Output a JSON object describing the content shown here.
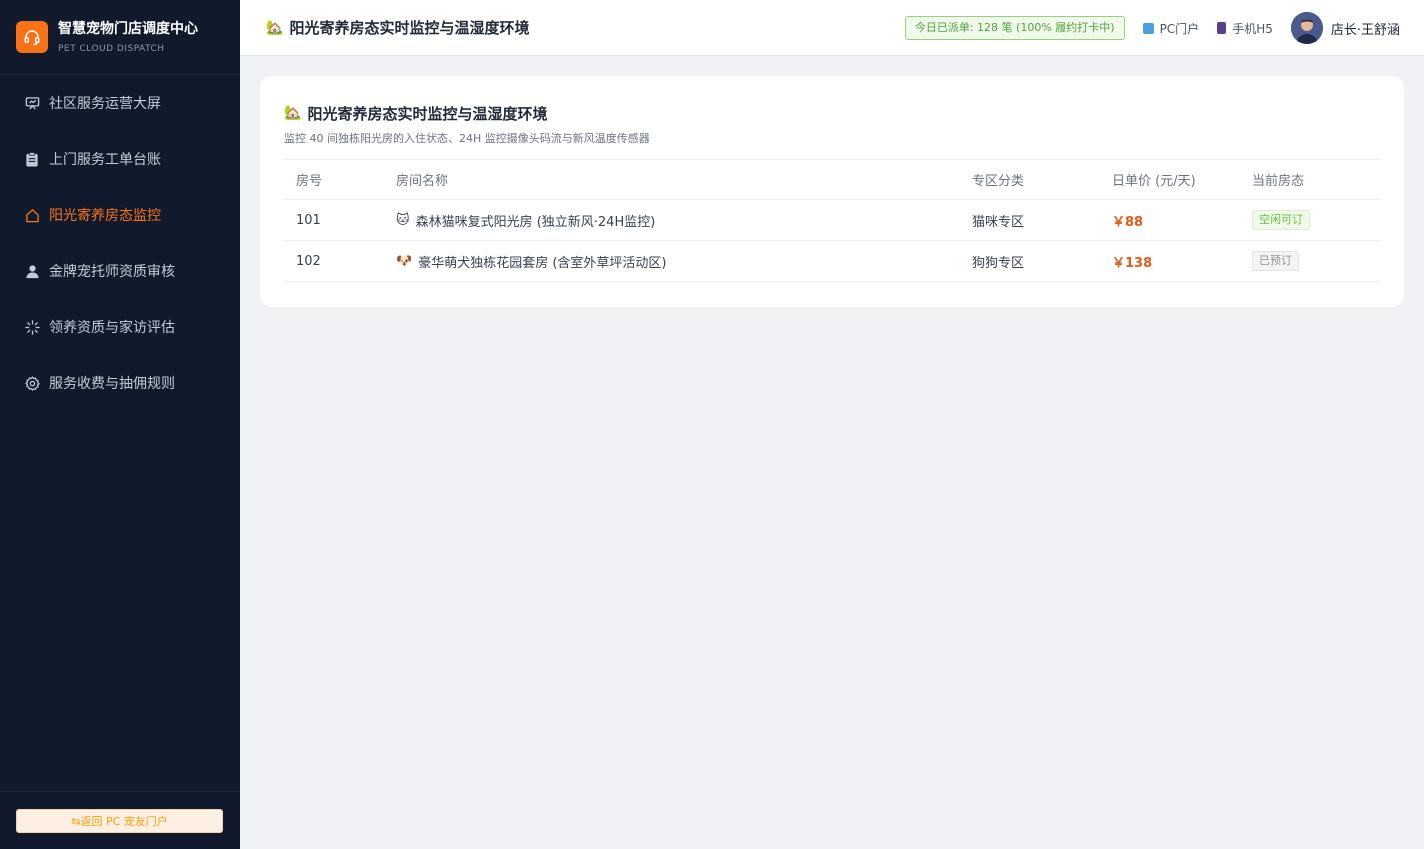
{
  "brand": {
    "title": "智慧宠物门店调度中心",
    "subtitle": "PET CLOUD DISPATCH",
    "logo_icon": "headset-icon",
    "accent": "#f97316"
  },
  "sidebar": {
    "items": [
      {
        "label": "社区服务运营大屏",
        "icon": "dashboard-icon",
        "active": false
      },
      {
        "label": "上门服务工单台账",
        "icon": "clipboard-icon",
        "active": false
      },
      {
        "label": "阳光寄养房态监控",
        "icon": "home-icon",
        "active": true
      },
      {
        "label": "金牌宠托师资质审核",
        "icon": "user-icon",
        "active": false
      },
      {
        "label": "领养资质与家访评估",
        "icon": "loading-icon",
        "active": false
      },
      {
        "label": "服务收费与抽佣规则",
        "icon": "gear-icon",
        "active": false
      }
    ],
    "back_button": "⇆返回 PC 宠友门户"
  },
  "header": {
    "emoji": "🏡",
    "title": "阳光寄养房态实时监控与温湿度环境",
    "dispatch_badge": "今日已派单: 128 笔 (100% 履约打卡中)",
    "pc_link": "PC门户",
    "mobile_link": "手机H5",
    "user_name": "店长·王舒涵"
  },
  "card": {
    "emoji": "🏡",
    "title": "阳光寄养房态实时监控与温湿度环境",
    "subtitle": "监控 40 间独栋阳光房的入住状态、24H 监控摄像头码流与新风温度传感器",
    "columns": [
      "房号",
      "房间名称",
      "专区分类",
      "日单价 (元/天)",
      "当前房态"
    ],
    "rows": [
      {
        "room_no": "101",
        "emoji": "🐱",
        "name": "森林猫咪复式阳光房 (独立新风·24H监控)",
        "zone": "猫咪专区",
        "price": "￥88",
        "status": "空闲可订",
        "status_type": "available"
      },
      {
        "room_no": "102",
        "emoji": "🐶",
        "name": "豪华萌犬独栋花园套房 (含室外草坪活动区)",
        "zone": "狗狗专区",
        "price": "￥138",
        "status": "已预订",
        "status_type": "booked"
      }
    ]
  }
}
